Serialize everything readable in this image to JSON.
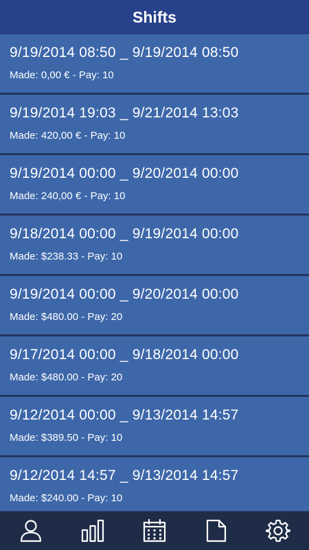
{
  "header": {
    "title": "Shifts"
  },
  "shifts": [
    {
      "range": "9/19/2014 08:50 _ 9/19/2014 08:50",
      "summary": "Made: 0,00 € - Pay: 10"
    },
    {
      "range": "9/19/2014 19:03 _ 9/21/2014 13:03",
      "summary": "Made: 420,00 € - Pay: 10"
    },
    {
      "range": "9/19/2014 00:00 _ 9/20/2014 00:00",
      "summary": "Made: 240,00 € - Pay: 10"
    },
    {
      "range": "9/18/2014 00:00 _ 9/19/2014 00:00",
      "summary": "Made: $238.33 - Pay: 10"
    },
    {
      "range": "9/19/2014 00:00 _ 9/20/2014 00:00",
      "summary": "Made: $480.00 - Pay: 20"
    },
    {
      "range": "9/17/2014 00:00 _ 9/18/2014 00:00",
      "summary": "Made: $480.00 - Pay: 20"
    },
    {
      "range": "9/12/2014 00:00 _ 9/13/2014 14:57",
      "summary": "Made: $389.50 - Pay: 10"
    },
    {
      "range": "9/12/2014 14:57 _ 9/13/2014 14:57",
      "summary": "Made: $240.00 - Pay: 10"
    }
  ],
  "tabbar": {
    "tabs": [
      {
        "icon": "person-icon"
      },
      {
        "icon": "bar-chart-icon"
      },
      {
        "icon": "calendar-icon"
      },
      {
        "icon": "document-icon"
      },
      {
        "icon": "gear-icon"
      }
    ]
  }
}
